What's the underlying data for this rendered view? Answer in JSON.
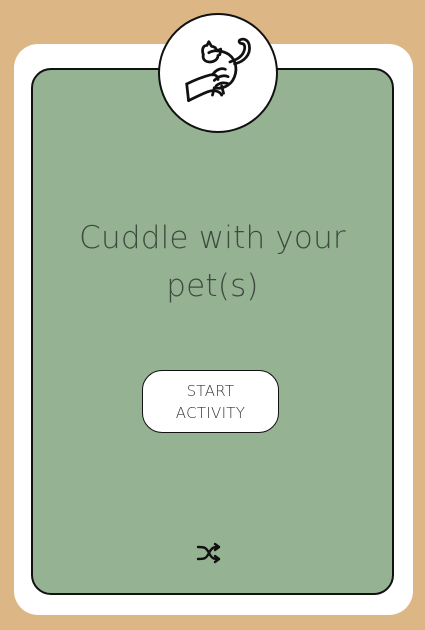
{
  "card": {
    "title_line1": "Cuddle with your",
    "title_line2": "pet(s)"
  },
  "actions": {
    "start_line1": "START",
    "start_line2": "ACTIVITY"
  },
  "icons": {
    "badge": "cat-cuddle-icon",
    "shuffle": "shuffle-icon"
  },
  "colors": {
    "background": "#ddb685",
    "card_outer": "#ffffff",
    "card_inner": "#95b393",
    "text": "#3f4a3f"
  }
}
